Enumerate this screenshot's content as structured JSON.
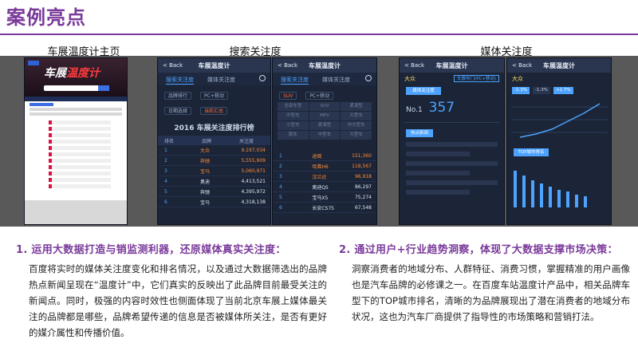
{
  "page": {
    "title": "案例亮点"
  },
  "captions": {
    "c1": "车展温度计主页",
    "c2": "搜索关注度",
    "c3": "媒体关注度"
  },
  "screens": {
    "home": {
      "hero_a": "车展",
      "hero_b": "温度计"
    },
    "search": {
      "back": "< Back",
      "title": "车展温度计",
      "tab_a": "搜索关注度",
      "tab_b": "媒体关注度",
      "sel_a": "品牌排行",
      "sel_b": "PC+移动",
      "sel_c": "日期选择",
      "sel_d": "当前汇总",
      "ranking_title": "2016 车展关注度排行榜",
      "headers": [
        "排名",
        "品牌",
        "关注度"
      ],
      "rows": [
        {
          "rank": "1",
          "brand": "大众",
          "value": "9,197,034"
        },
        {
          "rank": "2",
          "brand": "奔驰",
          "value": "5,555,909"
        },
        {
          "rank": "3",
          "brand": "宝马",
          "value": "5,060,971"
        },
        {
          "rank": "4",
          "brand": "奥迪",
          "value": "4,413,521"
        },
        {
          "rank": "5",
          "brand": "奔驰",
          "value": "4,395,972"
        },
        {
          "rank": "6",
          "brand": "宝马",
          "value": "4,318,138"
        }
      ]
    },
    "search2": {
      "back": "< Back",
      "title": "车展温度计",
      "sel_a": "SUV",
      "sel_b": "PC+移动",
      "grid": [
        "全部车型",
        "SUV",
        "紧凑型",
        "中型车",
        "MPV",
        "大型车",
        "小型车",
        "紧凑型",
        "中大型车",
        "跑车",
        "中型车",
        "大型车"
      ],
      "rows": [
        {
          "rank": "1",
          "brand": "途观",
          "value": "151,360"
        },
        {
          "rank": "2",
          "brand": "哈弗H6",
          "value": "118,567"
        },
        {
          "rank": "3",
          "brand": "汉兰达",
          "value": "96,918"
        },
        {
          "rank": "4",
          "brand": "奥迪Q5",
          "value": "86,297"
        },
        {
          "rank": "5",
          "brand": "宝马X5",
          "value": "75,274"
        },
        {
          "rank": "6",
          "brand": "长安CS75",
          "value": "67,548"
        }
      ]
    },
    "media": {
      "back": "< Back",
      "title": "车展温度计",
      "brand": "大众",
      "pill": "车展热门(PC+移动)",
      "tab_btn": "媒体关注度",
      "rank_label": "No.1",
      "score": "357",
      "hot_btn": "热点新闻"
    },
    "media2": {
      "back": "< Back",
      "title": "车展温度计",
      "brand": "大众",
      "v1": "-1.3%",
      "v2": "-1.3%",
      "v3": "+1.7%",
      "top_label": "TOP城市排名"
    }
  },
  "left": {
    "heading": "1. 运用大数据打造与销监测利器，还原媒体真实关注度：",
    "body": "百度将实时的媒体关注度变化和排名情况，以及通过大数据筛选出的品牌热点新闻呈现在“温度计”中，它们真实的反映出了此品牌目前最受关注的新闻点。同时，极强的内容时效性也侧面体现了当前北京车展上媒体最关注的品牌都是哪些，品牌希望传递的信息是否被媒体所关注，是否有更好的媒介属性和传播价值。"
  },
  "right": {
    "heading": "2. 通过用户+行业趋势洞察，体现了大数据支撑市场决策：",
    "body": "洞察消费者的地域分布、人群特征、消费习惯，掌握精准的用户画像也是汽车品牌的必修课之一。在百度车站温度计产品中，相关品牌车型下的TOP城市排名，清晰的为品牌展现出了潜在消费者的地域分布状况，这也为汽车厂商提供了指导性的市场策略和营销打法。"
  }
}
